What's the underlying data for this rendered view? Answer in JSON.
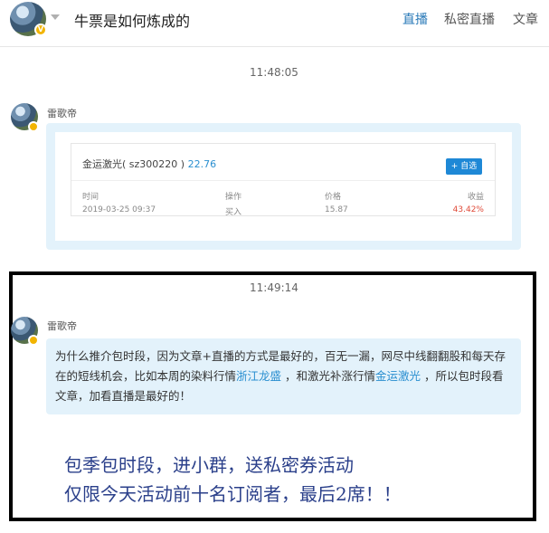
{
  "header": {
    "title": "牛票是如何炼成的",
    "tabs": [
      {
        "label": "直播",
        "active": true
      },
      {
        "label": "私密直播",
        "active": false
      },
      {
        "label": "文章",
        "active": false
      }
    ]
  },
  "messages": [
    {
      "time": "11:48:05",
      "author": "雷歌帝",
      "stock": {
        "name": "金运激光( sz300220 )",
        "price": "22.76",
        "add_label": "+ 自选",
        "columns": [
          "时间",
          "操作",
          "价格",
          "收益"
        ],
        "row": [
          "2019-03-25 09:37",
          "买入",
          "15.87",
          "43.42%"
        ]
      }
    },
    {
      "time": "11:49:14",
      "author": "雷歌帝",
      "text_parts": [
        "为什么推介包时段，因为文章+直播的方式是最好的，百无一漏，网尽中线翻翻股和每天存在的短线机会，比如本周的染料行情",
        "浙江龙盛",
        " ，和激光补涨行情",
        "金运激光",
        " ，所以包时段看文章，加看直播是最好的！"
      ],
      "promo_lines": [
        "包季包时段，进小群，送私密券活动",
        "仅限今天活动前十名订阅者，最后2席！！"
      ]
    }
  ],
  "colors": {
    "accent": "#2a7ab8",
    "link": "#2a8fd0",
    "bubble": "#e3f2fb",
    "profit": "#e04b3a",
    "promo": "#2a3f8a"
  }
}
